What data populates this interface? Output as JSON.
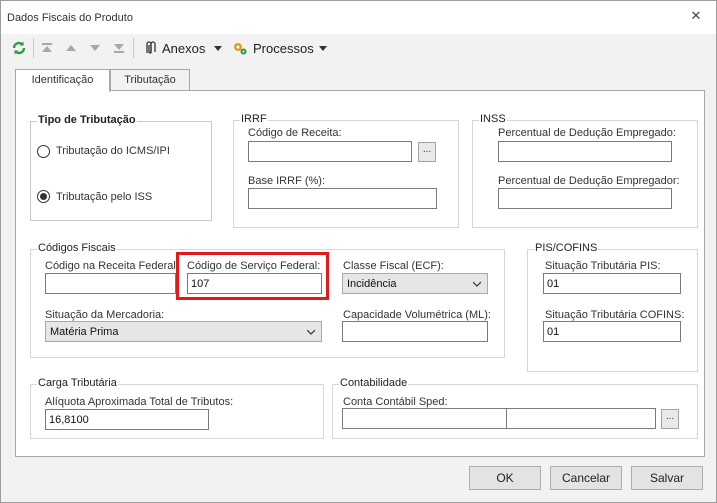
{
  "window": {
    "title": "Dados Fiscais do Produto",
    "close_glyph": "✕"
  },
  "toolbar": {
    "refresh_icon": "refresh-icon",
    "anexos_label": "Anexos",
    "processos_label": "Processos"
  },
  "tabs": [
    {
      "label": "Identificação",
      "active": true
    },
    {
      "label": "Tributação",
      "active": false
    }
  ],
  "tipo_tributacao": {
    "legend": "Tipo de Tributação",
    "options": [
      {
        "label": "Tributação do ICMS/IPI",
        "selected": false
      },
      {
        "label": "Tributação pelo ISS",
        "selected": true
      }
    ]
  },
  "irrf": {
    "legend": "IRRF",
    "codigo_receita_label": "Código de Receita:",
    "codigo_receita_value": "",
    "base_label": "Base IRRF (%):",
    "base_value": "",
    "ellipsis": "..."
  },
  "inss": {
    "legend": "INSS",
    "empregado_label": "Percentual de Dedução Empregado:",
    "empregado_value": "",
    "empregador_label": "Percentual de Dedução Empregador:",
    "empregador_value": ""
  },
  "codigos_fiscais": {
    "legend": "Códigos Fiscais",
    "receita_federal_label": "Código na Receita Federal:",
    "receita_federal_value": "",
    "servico_federal_label": "Código de Serviço Federal:",
    "servico_federal_value": "107",
    "classe_fiscal_label": "Classe Fiscal (ECF):",
    "classe_fiscal_value": "Incidência",
    "situacao_mercadoria_label": "Situação da Mercadoria:",
    "situacao_mercadoria_value": "Matéria Prima",
    "capacidade_label": "Capacidade Volumétrica (ML):",
    "capacidade_value": ""
  },
  "pis_cofins": {
    "legend": "PIS/COFINS",
    "pis_label": "Situação Tributária PIS:",
    "pis_value": "01",
    "cofins_label": "Situação Tributária COFINS:",
    "cofins_value": "01"
  },
  "carga_tributaria": {
    "legend": "Carga Tributária",
    "aliquota_label": "Alíquota Aproximada Total de Tributos:",
    "aliquota_value": "16,8100"
  },
  "contabilidade": {
    "legend": "Contabilidade",
    "conta_label": "Conta Contábil Sped:",
    "conta_value_1": "",
    "conta_value_2": "",
    "ellipsis": "..."
  },
  "buttons": {
    "ok": "OK",
    "cancel": "Cancelar",
    "save": "Salvar"
  },
  "colors": {
    "highlight": "#e11b1b",
    "refresh_green": "#2e9a3a"
  }
}
